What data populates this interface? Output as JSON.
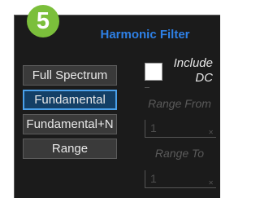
{
  "step_number": "5",
  "panel": {
    "title": "Harmonic Filter"
  },
  "filter_buttons": [
    {
      "label": "Full Spectrum",
      "selected": false
    },
    {
      "label": "Fundamental",
      "selected": true
    },
    {
      "label": "Fundamental+N",
      "selected": false
    },
    {
      "label": "Range",
      "selected": false
    }
  ],
  "include_dc": {
    "label_line1": "Include",
    "label_line2": "DC",
    "checked": false
  },
  "range_from": {
    "label": "Range From",
    "value": "1"
  },
  "range_to": {
    "label": "Range To",
    "value": "1"
  },
  "colors": {
    "badge": "#7bbf3b",
    "title": "#2e80e6",
    "selected_border": "#4aa0ea",
    "panel_bg": "#1b1b1b"
  }
}
